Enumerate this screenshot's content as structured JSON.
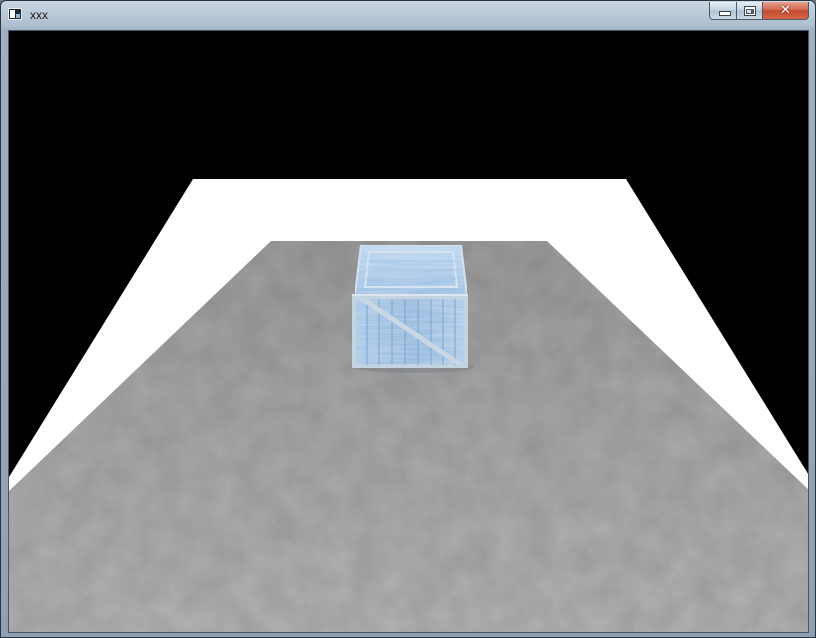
{
  "window": {
    "title": "xxx",
    "icon": "app-window-icon"
  },
  "caption_buttons": {
    "minimize_icon": "minimize-icon",
    "maximize_icon": "maximize-icon",
    "close_glyph": "✕"
  },
  "scene": {
    "background_color": "#000000",
    "skirt_color": "#ffffff",
    "floor_color": "#a4a4a4",
    "crate_color": "#8fb6dc"
  }
}
